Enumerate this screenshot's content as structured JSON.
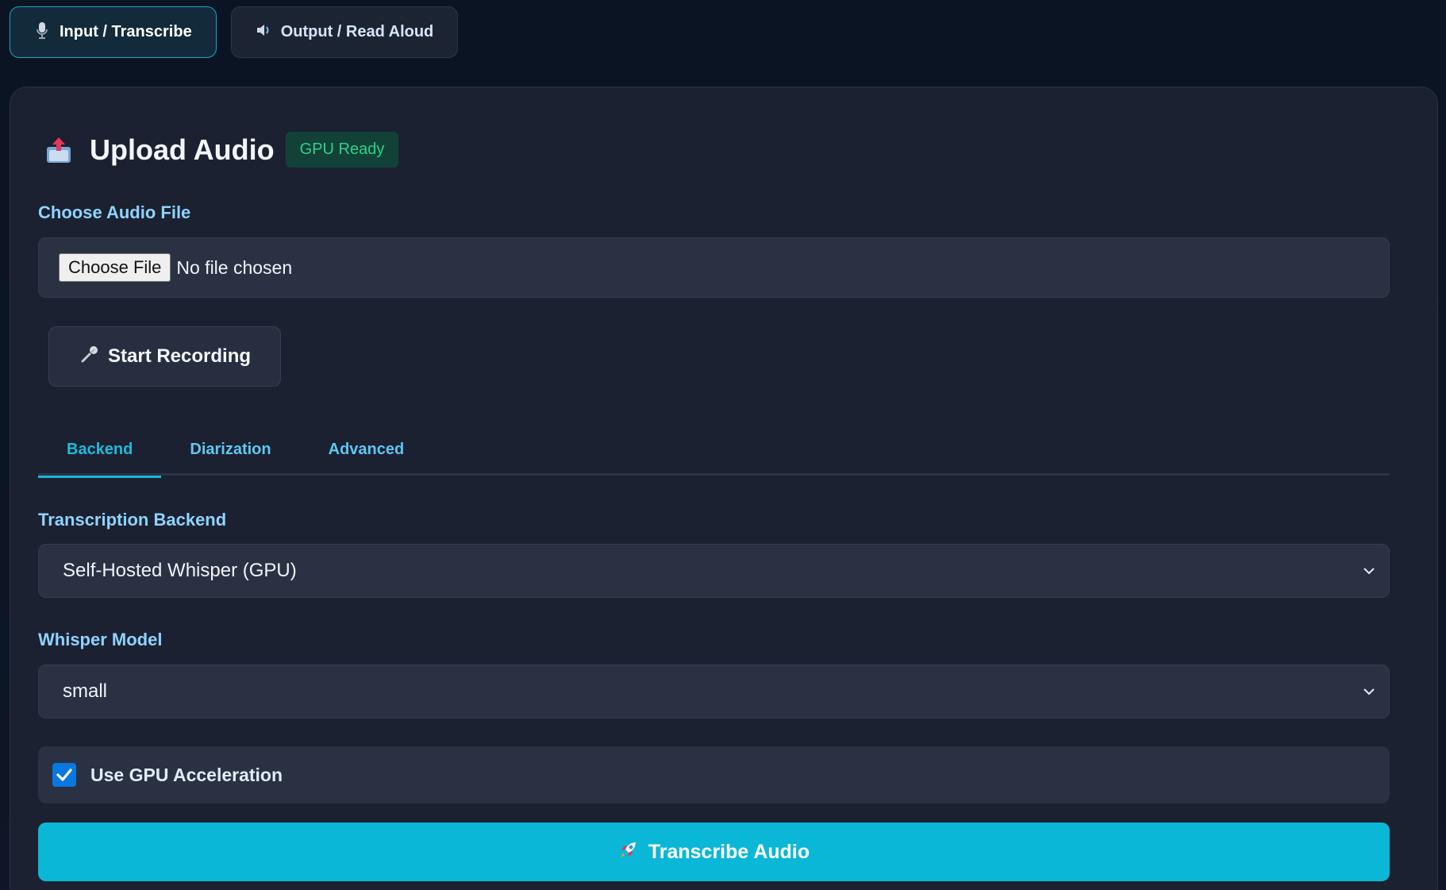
{
  "top_tabs": [
    {
      "label": "Input / Transcribe",
      "icon": "microphone-icon",
      "active": true
    },
    {
      "label": "Output / Read Aloud",
      "icon": "speaker-icon",
      "active": false
    }
  ],
  "card": {
    "title": "Upload Audio",
    "title_icon": "upload-icon",
    "badge": "GPU Ready",
    "file": {
      "label": "Choose Audio File",
      "button_label": "Choose File",
      "status": "No file chosen"
    },
    "record_button": {
      "label": "Start Recording",
      "icon": "microphone-icon"
    },
    "sub_tabs": [
      {
        "label": "Backend",
        "active": true
      },
      {
        "label": "Diarization",
        "active": false
      },
      {
        "label": "Advanced",
        "active": false
      }
    ],
    "backend": {
      "label": "Transcription Backend",
      "selected": "Self-Hosted Whisper (GPU)"
    },
    "model": {
      "label": "Whisper Model",
      "selected": "small"
    },
    "gpu": {
      "label": "Use GPU Acceleration",
      "checked": true
    },
    "submit": {
      "label": "Transcribe Audio",
      "icon": "rocket-icon"
    }
  },
  "colors": {
    "accent": "#0bb7d6",
    "badge_text": "#31d08a",
    "label": "#8fd3ff",
    "checkbox": "#0a78e0"
  }
}
